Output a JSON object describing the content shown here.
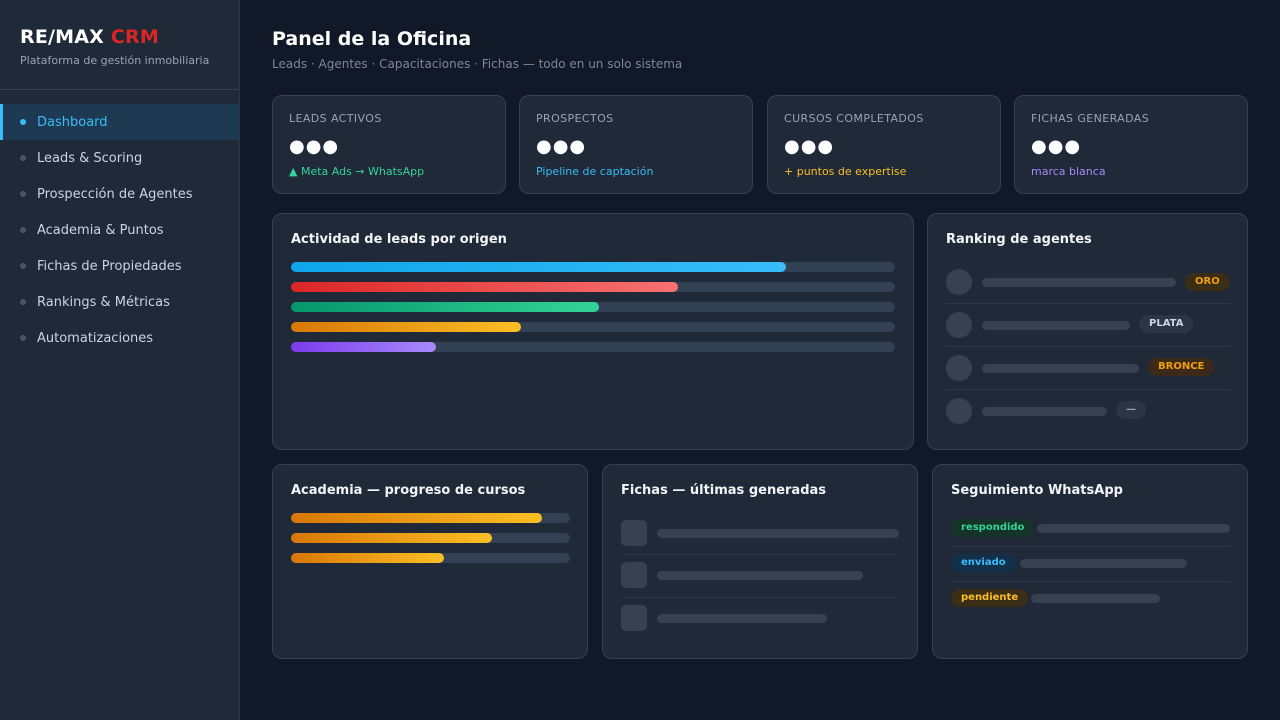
{
  "brand": {
    "title_main": "RE/MAX",
    "title_accent": "CRM",
    "subtitle": "Plataforma de gestión inmobiliaria"
  },
  "sidebar": {
    "items": [
      {
        "label": "Dashboard",
        "active": true
      },
      {
        "label": "Leads & Scoring"
      },
      {
        "label": "Prospección de Agentes"
      },
      {
        "label": "Academia & Puntos"
      },
      {
        "label": "Fichas de Propiedades"
      },
      {
        "label": "Rankings & Métricas"
      },
      {
        "label": "Automatizaciones"
      }
    ]
  },
  "header": {
    "title": "Panel de la Oficina",
    "subtitle": "Leads · Agentes · Capacitaciones · Fichas — todo en un solo sistema"
  },
  "stats": [
    {
      "label": "LEADS ACTIVOS",
      "value": "●●●",
      "note": "▲ Meta Ads → WhatsApp",
      "color": "#34d399"
    },
    {
      "label": "PROSPECTOS",
      "value": "●●●",
      "note": "Pipeline de captación",
      "color": "#38bdf8"
    },
    {
      "label": "CURSOS COMPLETADOS",
      "value": "●●●",
      "note": "+ puntos de expertise",
      "color": "#fbbf24"
    },
    {
      "label": "FICHAS GENERADAS",
      "value": "●●●",
      "note": "marca blanca",
      "color": "#a78bfa"
    }
  ],
  "activity": {
    "title": "Actividad de leads por origen",
    "bars": [
      {
        "fill": 0.82,
        "from": "#0ea5e9",
        "to": "#38bdf8"
      },
      {
        "fill": 0.64,
        "from": "#dc2626",
        "to": "#f87171"
      },
      {
        "fill": 0.51,
        "from": "#059669",
        "to": "#34d399"
      },
      {
        "fill": 0.38,
        "from": "#d97706",
        "to": "#fbbf24"
      },
      {
        "fill": 0.24,
        "from": "#7c3aed",
        "to": "#a78bfa"
      }
    ]
  },
  "ranking": {
    "title": "Ranking de agentes",
    "rows": [
      {
        "badge": "ORO",
        "color": "#f59e0b",
        "bg": "#3a2e17"
      },
      {
        "badge": "PLATA",
        "color": "#cbd5e1",
        "bg": "#2b3543"
      },
      {
        "badge": "BRONCE",
        "color": "#f59e0b",
        "bg": "#3a2a17"
      },
      {
        "badge": "—",
        "color": "#94a3b8",
        "bg": "#2b3543"
      }
    ]
  },
  "academia": {
    "title": "Academia — progreso de cursos",
    "bars": [
      {
        "fill": 0.9
      },
      {
        "fill": 0.72
      },
      {
        "fill": 0.55
      }
    ]
  },
  "fichas": {
    "title": "Fichas — últimas generadas"
  },
  "whatsapp": {
    "title": "Seguimiento WhatsApp",
    "rows": [
      {
        "status": "respondido",
        "color": "#34d399",
        "bg": "#143329"
      },
      {
        "status": "enviado",
        "color": "#38bdf8",
        "bg": "#13304a"
      },
      {
        "status": "pendiente",
        "color": "#fbbf24",
        "bg": "#3a2e17"
      }
    ]
  }
}
